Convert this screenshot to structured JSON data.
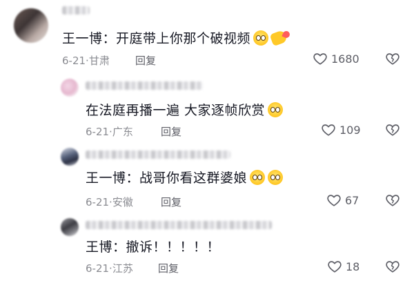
{
  "comments": [
    {
      "text": "王一博：开庭带上你那个破视频",
      "date": "6-21",
      "location": "甘肃",
      "reply_label": "回复",
      "likes": "1680",
      "emojis": [
        "slightly-smiling-face-emoji",
        "pointing-hand-emoji"
      ]
    },
    {
      "text": "在法庭再播一遍  大家逐帧欣赏",
      "date": "6-21",
      "location": "广东",
      "reply_label": "回复",
      "likes": "109",
      "emojis": [
        "sparkle-smile-emoji"
      ]
    },
    {
      "text": "王一博：战哥你看这群婆娘",
      "date": "6-21",
      "location": "安徽",
      "reply_label": "回复",
      "likes": "67",
      "emojis": [
        "pleading-face-emoji",
        "surprised-face-emoji"
      ]
    },
    {
      "text": "王博：撤诉！！！！！",
      "date": "6-21",
      "location": "江苏",
      "reply_label": "回复",
      "likes": "18",
      "emojis": []
    }
  ],
  "icons": {
    "like": "heart-outline-icon",
    "dislike": "broken-heart-icon"
  },
  "colors": {
    "text": "#161823",
    "meta": "#8a8b91",
    "icon": "#5d5e66"
  }
}
